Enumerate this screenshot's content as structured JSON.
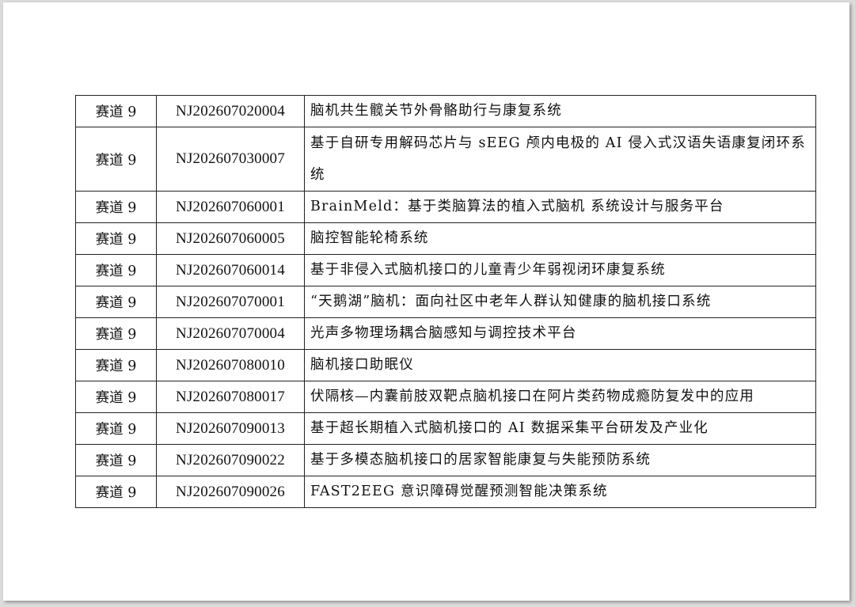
{
  "rows": [
    {
      "track": "赛道 9",
      "code": "NJ202607020004",
      "title": "脑机共生髋关节外骨骼助行与康复系统"
    },
    {
      "track": "赛道 9",
      "code": "NJ202607030007",
      "title": "基于自研专用解码芯片与 sEEG 颅内电极的 AI 侵入式汉语失语康复闭环系统"
    },
    {
      "track": "赛道 9",
      "code": "NJ202607060001",
      "title": "BrainMeld：基于类脑算法的植入式脑机 系统设计与服务平台"
    },
    {
      "track": "赛道 9",
      "code": "NJ202607060005",
      "title": "脑控智能轮椅系统"
    },
    {
      "track": "赛道 9",
      "code": "NJ202607060014",
      "title": "基于非侵入式脑机接口的儿童青少年弱视闭环康复系统"
    },
    {
      "track": "赛道 9",
      "code": "NJ202607070001",
      "title": "“天鹅湖”脑机：面向社区中老年人群认知健康的脑机接口系统"
    },
    {
      "track": "赛道 9",
      "code": "NJ202607070004",
      "title": "光声多物理场耦合脑感知与调控技术平台"
    },
    {
      "track": "赛道 9",
      "code": "NJ202607080010",
      "title": "脑机接口助眠仪"
    },
    {
      "track": "赛道 9",
      "code": "NJ202607080017",
      "title": "伏隔核—内囊前肢双靶点脑机接口在阿片类药物成瘾防复发中的应用"
    },
    {
      "track": "赛道 9",
      "code": "NJ202607090013",
      "title": "基于超长期植入式脑机接口的 AI 数据采集平台研发及产业化"
    },
    {
      "track": "赛道 9",
      "code": "NJ202607090022",
      "title": "基于多模态脑机接口的居家智能康复与失能预防系统"
    },
    {
      "track": "赛道 9",
      "code": "NJ202607090026",
      "title": "FAST2EEG 意识障碍觉醒预测智能决策系统"
    }
  ]
}
